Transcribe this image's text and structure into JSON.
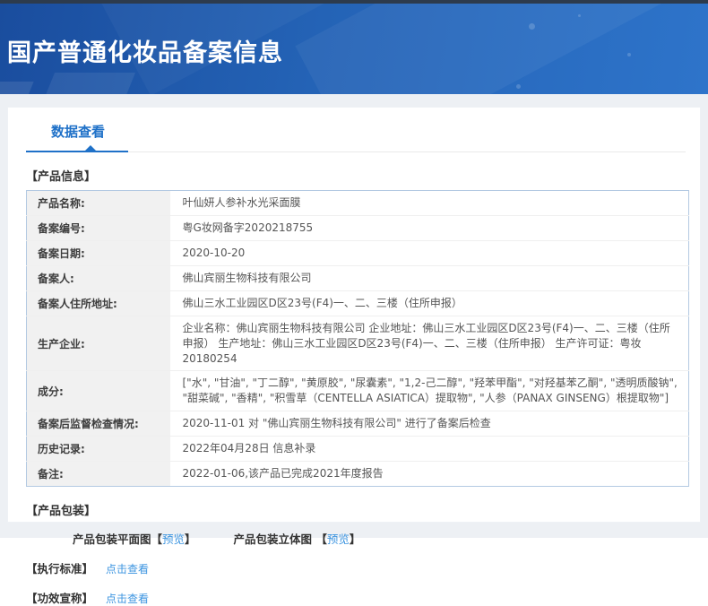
{
  "header": {
    "title": "国产普通化妆品备案信息"
  },
  "tab": {
    "label": "数据查看"
  },
  "product_info": {
    "section_title": "【产品信息】",
    "rows": [
      {
        "label": "产品名称:",
        "value": "叶仙妍人参补水光采面膜"
      },
      {
        "label": "备案编号:",
        "value": "粤G妆网备字2020218755"
      },
      {
        "label": "备案日期:",
        "value": "2020-10-20"
      },
      {
        "label": "备案人:",
        "value": "佛山宾丽生物科技有限公司"
      },
      {
        "label": "备案人住所地址:",
        "value": "佛山三水工业园区D区23号(F4)一、二、三楼（住所申报）"
      },
      {
        "label": "生产企业:",
        "value": "企业名称：佛山宾丽生物科技有限公司 企业地址：佛山三水工业园区D区23号(F4)一、二、三楼（住所申报） 生产地址：佛山三水工业园区D区23号(F4)一、二、三楼（住所申报） 生产许可证：粤妆20180254"
      },
      {
        "label": "成分:",
        "value": "[\"水\", \"甘油\", \"丁二醇\", \"黄原胶\", \"尿囊素\", \"1,2-己二醇\", \"羟苯甲酯\", \"对羟基苯乙酮\", \"透明质酸钠\", \"甜菜碱\", \"香精\", \"积雪草（CENTELLA ASIATICA）提取物\", \"人参（PANAX GINSENG）根提取物\"]"
      },
      {
        "label": "备案后监督检查情况:",
        "value": "2020-11-01 对 \"佛山宾丽生物科技有限公司\" 进行了备案后检查"
      },
      {
        "label": "历史记录:",
        "value": "2022年04月28日 信息补录"
      },
      {
        "label": "备注:",
        "value": "2022-01-06,该产品已完成2021年度报告"
      }
    ]
  },
  "packaging": {
    "section_title": "【产品包装】",
    "items": [
      {
        "prefix": "产品包装平面图【",
        "link": "预览",
        "suffix": "】"
      },
      {
        "prefix": "产品包装立体图 【",
        "link": "预览",
        "suffix": "】"
      }
    ]
  },
  "standard": {
    "section_title": "【执行标准】",
    "link": "点击查看"
  },
  "efficacy": {
    "section_title": "【功效宣称】",
    "link": "点击查看"
  },
  "colors": {
    "accent_blue": "#1f71c8",
    "link_blue": "#3d95e0",
    "banner_gradient_start": "#1a4d9e",
    "banner_gradient_end": "#2e74ca",
    "topbar": "#2d3b4d",
    "table_border": "#b3c9e2",
    "label_bg": "#f1f1f1",
    "band_bg": "#edf0f4"
  }
}
